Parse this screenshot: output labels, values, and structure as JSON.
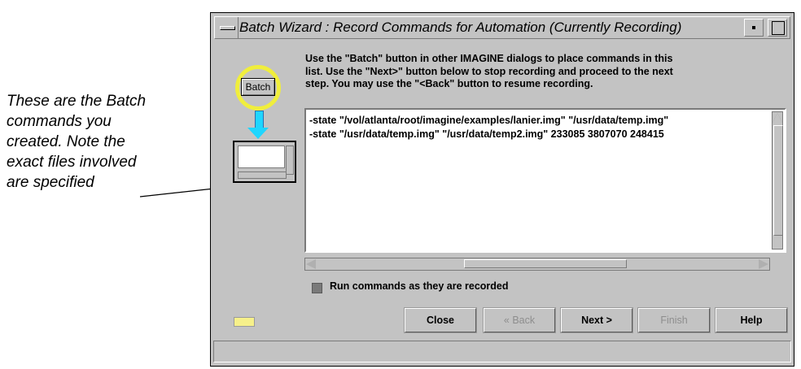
{
  "annotation": {
    "lines": [
      "These are the Batch",
      "commands you",
      "created. Note the",
      "exact files involved",
      "are specified"
    ]
  },
  "window": {
    "title": "Batch Wizard : Record Commands for Automation (Currently Recording)",
    "instructions": [
      "Use the \"Batch\" button in other IMAGINE dialogs to place commands in this",
      "list. Use the \"Next>\" button below to stop recording and proceed to the next",
      "step. You may use the \"<Back\" button to resume recording."
    ],
    "batch_button_label": "Batch",
    "commands": [
      "-state \"/vol/atlanta/root/imagine/examples/lanier.img\" \"/usr/data/temp.img\"",
      "-state \"/usr/data/temp.img\" \"/usr/data/temp2.img\" 233085 3807070 248415"
    ],
    "run_as_recorded_label": "Run commands as they are recorded",
    "run_as_recorded_checked": true,
    "buttons": {
      "close": "Close",
      "back": "« Back",
      "next": "Next >",
      "finish": "Finish",
      "help": "Help"
    }
  },
  "colors": {
    "window_bg": "#c3c3c3",
    "highlight_ring": "#f0ee3c",
    "arrow": "#1fd6ff",
    "status_led": "#f6f08a"
  }
}
